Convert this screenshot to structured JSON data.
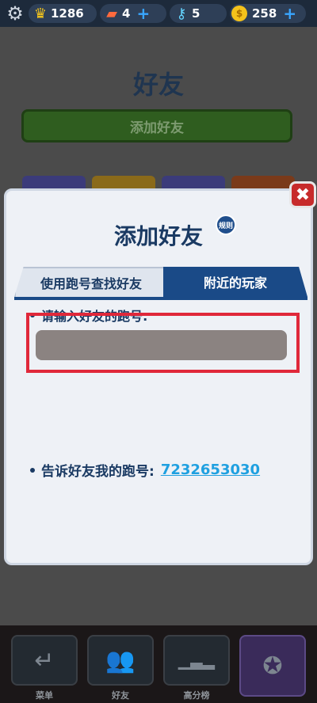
{
  "topbar": {
    "crown_count": "1286",
    "board_count": "4",
    "key_count": "5",
    "coin_count": "258"
  },
  "background": {
    "title": "好友",
    "add_friend_button": "添加好友"
  },
  "modal": {
    "title": "添加好友",
    "rules_badge": "规则",
    "tabs": [
      {
        "label": "使用跑号查找好友"
      },
      {
        "label": "附近的玩家"
      }
    ],
    "input_label": "请输入好友的跑号:",
    "input_placeholder": "",
    "share_label": "告诉好友我的跑号:",
    "my_id": "7232653030"
  },
  "bottom_nav": {
    "items": [
      {
        "label": "菜单"
      },
      {
        "label": "好友"
      },
      {
        "label": "高分榜"
      }
    ]
  },
  "colors": {
    "accent": "#1a4a87",
    "highlight": "#e0283a",
    "link": "#1fa0e0"
  }
}
